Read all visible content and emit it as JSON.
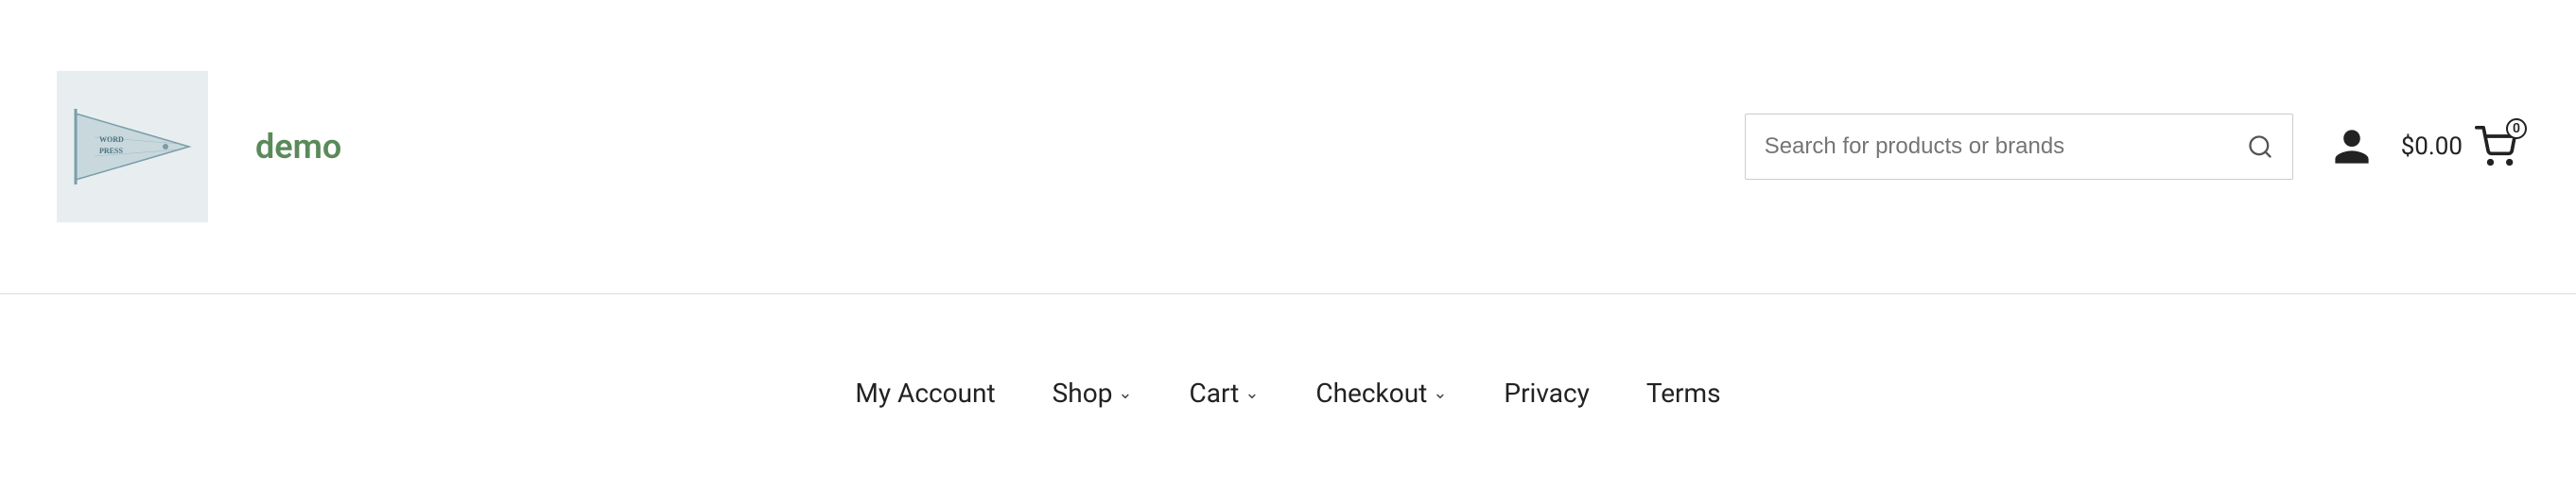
{
  "header": {
    "site_title": "demo",
    "logo_alt": "WordPress demo logo"
  },
  "search": {
    "placeholder": "Search for products or brands"
  },
  "cart": {
    "price": "$0.00",
    "badge_count": "0"
  },
  "nav": {
    "items": [
      {
        "label": "My Account",
        "has_dropdown": false
      },
      {
        "label": "Shop",
        "has_dropdown": true
      },
      {
        "label": "Cart",
        "has_dropdown": true
      },
      {
        "label": "Checkout",
        "has_dropdown": true
      },
      {
        "label": "Privacy",
        "has_dropdown": false
      },
      {
        "label": "Terms",
        "has_dropdown": false
      }
    ]
  },
  "colors": {
    "accent_green": "#5a8a5a",
    "divider": "#dddddd",
    "text": "#222222",
    "placeholder": "#999999",
    "logo_bg": "#e8eef0"
  }
}
